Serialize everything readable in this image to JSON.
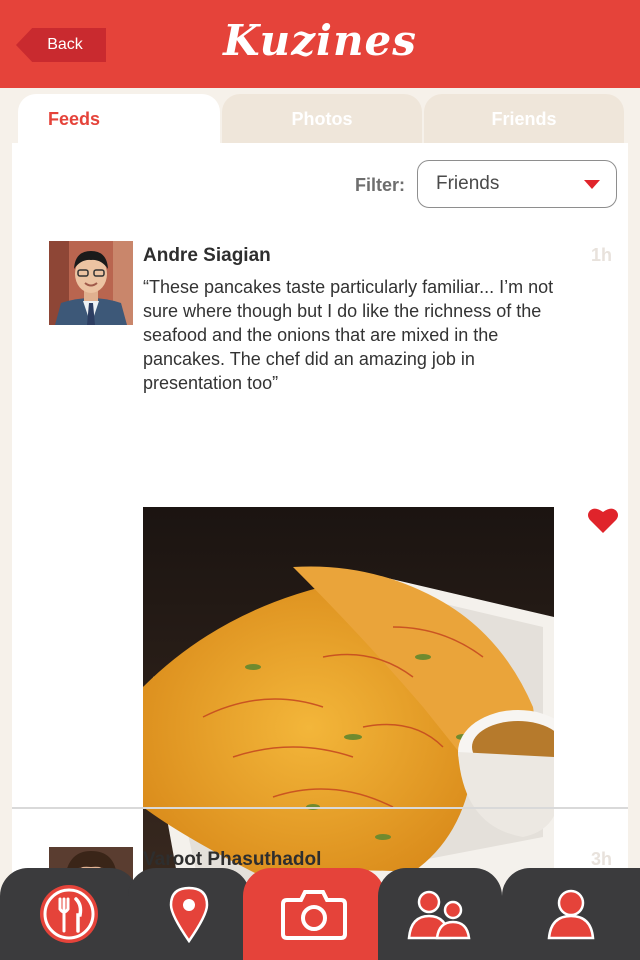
{
  "header": {
    "back_label": "Back",
    "logo_text": "Kuzines",
    "color": "#e5433a"
  },
  "tabs": [
    {
      "label": "Feeds",
      "active": true
    },
    {
      "label": "Photos",
      "active": false
    },
    {
      "label": "Friends",
      "active": false
    }
  ],
  "filter": {
    "label": "Filter:",
    "value": "Friends"
  },
  "posts": [
    {
      "author": "Andre Siagian",
      "time": "1h",
      "text": "“These pancakes taste particularly familiar... I’m not sure where though but I do like the richness of the seafood and the onions that are mixed in the pancakes. The chef did an amazing job in presentation too”",
      "liked": true
    },
    {
      "author": "Varoot Phasuthadol",
      "time": "3h"
    }
  ],
  "tabbar": {
    "items": [
      {
        "icon": "fork-knife-icon",
        "active": false
      },
      {
        "icon": "location-pin-icon",
        "active": false
      },
      {
        "icon": "camera-icon",
        "active": true
      },
      {
        "icon": "friends-icon",
        "active": false
      },
      {
        "icon": "profile-icon",
        "active": false
      }
    ]
  },
  "colors": {
    "accent": "#e5433a",
    "dark": "#3b3b3d",
    "tab_inactive": "#efe6da"
  }
}
